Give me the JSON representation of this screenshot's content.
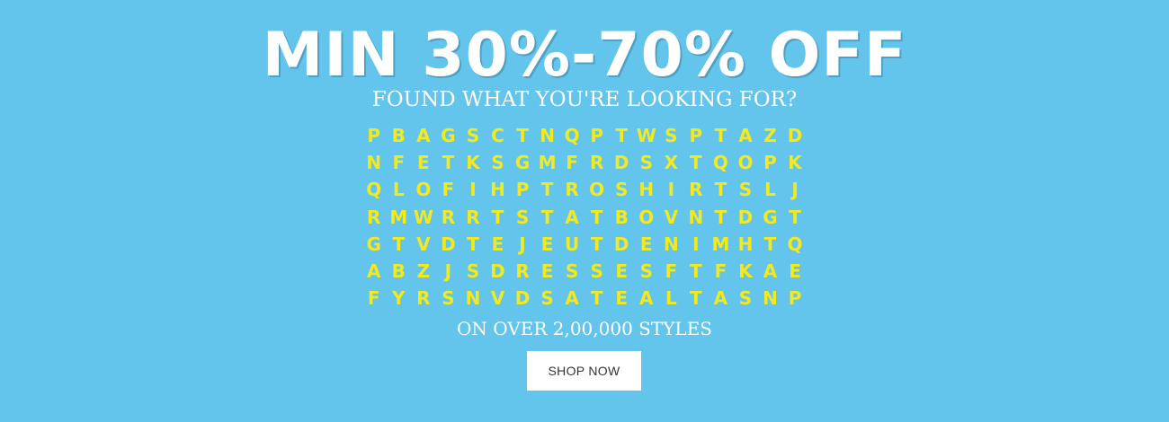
{
  "banner": {
    "headline": "MIN 30%-70% OFF",
    "subhead": "FOUND WHAT YOU'RE LOOKING FOR?",
    "tagline": "ON OVER 2,00,000 STYLES",
    "cta_label": "SHOP NOW",
    "colors": {
      "background": "#63c4ec",
      "letters": "#f2ea1f",
      "text": "#ffffff"
    }
  },
  "word_search": [
    [
      "P",
      "B",
      "A",
      "G",
      "S",
      "C",
      "T",
      "N",
      "Q",
      "P",
      "T",
      "W",
      "S",
      "P",
      "T",
      "A",
      "Z",
      "D"
    ],
    [
      "N",
      "F",
      "E",
      "T",
      "K",
      "S",
      "G",
      "M",
      "F",
      "R",
      "D",
      "S",
      "X",
      "T",
      "Q",
      "O",
      "P",
      "K"
    ],
    [
      "Q",
      "L",
      "O",
      "F",
      "I",
      "H",
      "P",
      "T",
      "R",
      "O",
      "S",
      "H",
      "I",
      "R",
      "T",
      "S",
      "L",
      "J"
    ],
    [
      "R",
      "M",
      "W",
      "R",
      "R",
      "T",
      "S",
      "T",
      "A",
      "T",
      "B",
      "O",
      "V",
      "N",
      "T",
      "D",
      "G",
      "T"
    ],
    [
      "G",
      "T",
      "V",
      "D",
      "T",
      "E",
      "J",
      "E",
      "U",
      "T",
      "D",
      "E",
      "N",
      "I",
      "M",
      "H",
      "T",
      "Q"
    ],
    [
      "A",
      "B",
      "Z",
      "J",
      "S",
      "D",
      "R",
      "E",
      "S",
      "S",
      "E",
      "S",
      "F",
      "T",
      "F",
      "K",
      "A",
      "E"
    ],
    [
      "F",
      "Y",
      "R",
      "S",
      "N",
      "V",
      "D",
      "S",
      "A",
      "T",
      "E",
      "A",
      "L",
      "T",
      "A",
      "S",
      "N",
      "P"
    ]
  ]
}
